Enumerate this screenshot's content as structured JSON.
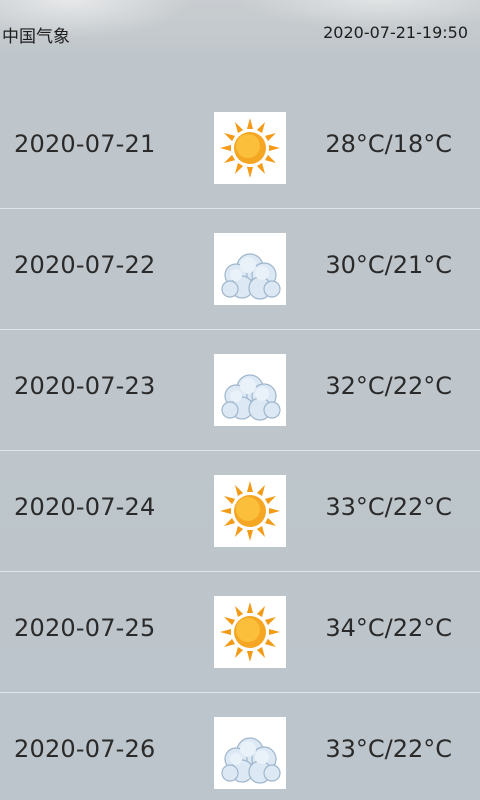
{
  "header": {
    "app_title": "中国气象",
    "datetime": "2020-07-21-19:50"
  },
  "forecast": [
    {
      "date": "2020-07-21",
      "icon": "sun-icon",
      "temp": "28°C/18°C"
    },
    {
      "date": "2020-07-22",
      "icon": "cloud-icon",
      "temp": "30°C/21°C"
    },
    {
      "date": "2020-07-23",
      "icon": "cloud-icon",
      "temp": "32°C/22°C"
    },
    {
      "date": "2020-07-24",
      "icon": "sun-icon",
      "temp": "33°C/22°C"
    },
    {
      "date": "2020-07-25",
      "icon": "sun-icon",
      "temp": "34°C/22°C"
    },
    {
      "date": "2020-07-26",
      "icon": "cloud-icon",
      "temp": "33°C/22°C"
    }
  ],
  "colors": {
    "background": "#bcc5cb",
    "sun": "#f7a21b",
    "cloud": "#c9dcef"
  }
}
